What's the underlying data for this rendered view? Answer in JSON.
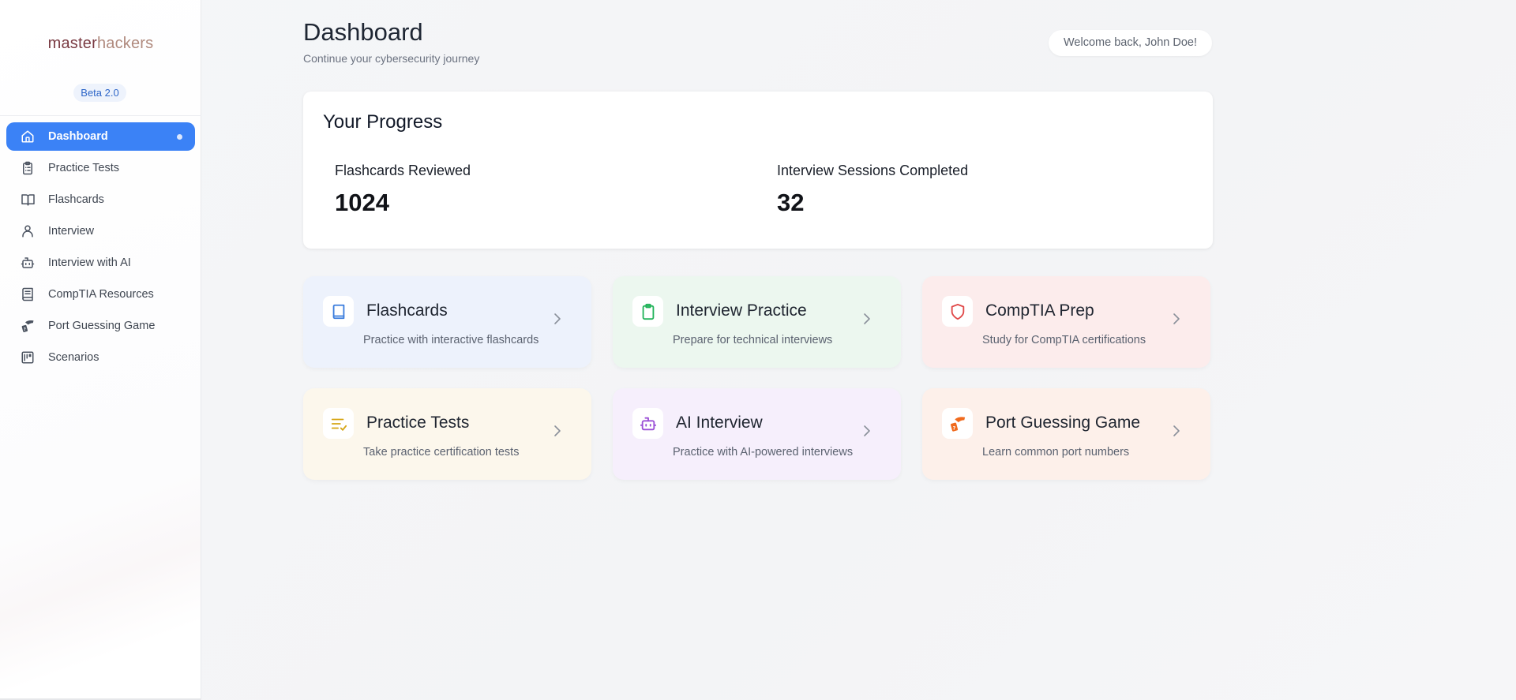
{
  "sidebar": {
    "brand_part1": "master",
    "brand_part2": "hackers",
    "badge": "Beta 2.0",
    "items": [
      {
        "label": "Dashboard",
        "icon": "home-icon",
        "active": true
      },
      {
        "label": "Practice Tests",
        "icon": "clipboard-list-icon"
      },
      {
        "label": "Flashcards",
        "icon": "book-open-icon"
      },
      {
        "label": "Interview",
        "icon": "user-icon"
      },
      {
        "label": "Interview with AI",
        "icon": "bot-icon"
      },
      {
        "label": "CompTIA Resources",
        "icon": "book-icon"
      },
      {
        "label": "Port Guessing Game",
        "icon": "hand-card-icon"
      },
      {
        "label": "Scenarios",
        "icon": "kanban-icon"
      }
    ]
  },
  "header": {
    "title": "Dashboard",
    "subtitle": "Continue your cybersecurity journey",
    "welcome": "Welcome back, John Doe!"
  },
  "progress": {
    "title": "Your Progress",
    "stats": [
      {
        "label": "Flashcards Reviewed",
        "value": "1024"
      },
      {
        "label": "Interview Sessions Completed",
        "value": "32"
      }
    ]
  },
  "cards": [
    {
      "title": "Flashcards",
      "description": "Practice with interactive flashcards",
      "icon": "book-icon",
      "color": "#3b7ddd",
      "bg": "#edf2fc"
    },
    {
      "title": "Interview Practice",
      "description": "Prepare for technical interviews",
      "icon": "clipboard-icon",
      "color": "#22b35a",
      "bg": "#ecf7ef"
    },
    {
      "title": "CompTIA Prep",
      "description": "Study for CompTIA certifications",
      "icon": "shield-icon",
      "color": "#e04848",
      "bg": "#fcecec"
    },
    {
      "title": "Practice Tests",
      "description": "Take practice certification tests",
      "icon": "list-checks-icon",
      "color": "#d6a514",
      "bg": "#fcf7ec"
    },
    {
      "title": "AI Interview",
      "description": "Practice with AI-powered interviews",
      "icon": "bot-icon",
      "color": "#9b4fd6",
      "bg": "#f6effc"
    },
    {
      "title": "Port Guessing Game",
      "description": "Learn common port numbers",
      "icon": "hand-card-icon",
      "color": "#f06a1d",
      "bg": "#fdf0ea"
    }
  ]
}
